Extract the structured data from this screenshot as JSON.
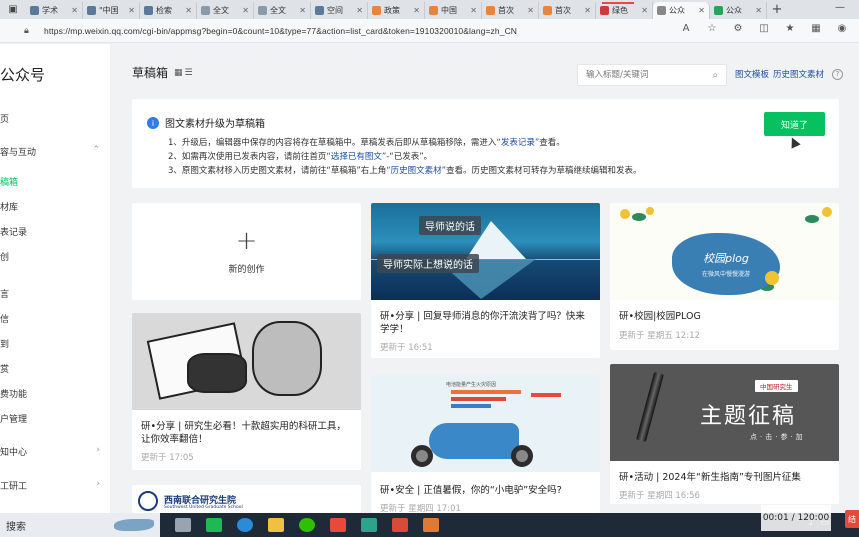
{
  "browser": {
    "tabs": [
      {
        "label": "学术",
        "color": "#5b7a99"
      },
      {
        "label": "\"中国",
        "color": "#5b7a99"
      },
      {
        "label": "检索",
        "color": "#5b7a99"
      },
      {
        "label": "全文",
        "color": "#8a9aa8"
      },
      {
        "label": "全文",
        "color": "#8a9aa8"
      },
      {
        "label": "空间",
        "color": "#5b7a99"
      },
      {
        "label": "政策",
        "color": "#e8843b"
      },
      {
        "label": "中国",
        "color": "#e8843b"
      },
      {
        "label": "首次",
        "color": "#e8843b"
      },
      {
        "label": "首次",
        "color": "#e8843b"
      },
      {
        "label": "绿色",
        "color": "#d0393b"
      },
      {
        "label": "公众",
        "color": "#888888"
      },
      {
        "label": "公众",
        "color": "#2aa35a"
      }
    ],
    "url": "https://mp.weixin.qq.com/cgi-bin/appmsg?begin=0&count=10&type=77&action=list_card&token=1910320010&lang=zh_CN"
  },
  "sidebar": {
    "logo": "公众号",
    "items": [
      {
        "label": "页",
        "chevron": ""
      },
      {
        "label": "容与互动",
        "chevron": "⌃"
      },
      {
        "label": "稿箱",
        "chevron": ""
      },
      {
        "label": "材库",
        "chevron": ""
      },
      {
        "label": "表记录",
        "chevron": ""
      },
      {
        "label": "创",
        "chevron": ""
      },
      {
        "label": "言",
        "chevron": ""
      },
      {
        "label": "信",
        "chevron": ""
      },
      {
        "label": "到",
        "chevron": ""
      },
      {
        "label": "赏",
        "chevron": ""
      },
      {
        "label": "费功能",
        "chevron": ""
      },
      {
        "label": "户管理",
        "chevron": ""
      },
      {
        "label": "知中心",
        "chevron": "›"
      },
      {
        "label": "工研工",
        "chevron": "›"
      }
    ]
  },
  "header": {
    "title": "草稿箱",
    "search_placeholder": "输入标题/关键词",
    "link_templates": "图文模板",
    "link_history": "历史图文素材",
    "help": "?"
  },
  "notice": {
    "title": "图文素材升级为草稿箱",
    "line1_a": "1、升级后，编辑器中保存的内容将存在草稿箱中。草稿发表后即从草稿箱移除，需进入",
    "line1_link": "“发表记录”",
    "line1_b": "查看。",
    "line2_a": "2、如需再次使用已发表内容，请前往首页",
    "line2_link": "“选择已有图文”",
    "line2_b": "-“已发表”。",
    "line3_a": "3、原图文素材移入历史图文素材，请前往“草稿箱”右上角",
    "line3_link": "“历史图文素材”",
    "line3_b": "查看。历史图文素材可转存为草稿继续编辑和发表。",
    "button": "知道了"
  },
  "cards": {
    "new": {
      "label": "新的创作"
    },
    "c1": {
      "tag1": "导师说的话",
      "tag2": "导师实际上想说的话",
      "title": "研•分享 | 回复导师消息的你汗流浃背了吗？快来学学！",
      "time": "更新于 16:51"
    },
    "c2": {
      "big": "校园plog",
      "sub": "在微风中慢慢漫游",
      "title": "研•校园|校园PLOG",
      "time": "更新于 星期五 12:12"
    },
    "c3": {
      "title": "研•分享 | 研究生必看！十款超实用的科研工具，让你效率翻倍！",
      "time": "更新于 17:05"
    },
    "c4": {
      "chart_title": "电池能量产生火灾原因",
      "title": "研•安全 | 正值暑假，你的“小电驴”安全吗?",
      "time": "更新于 星期四 17:01"
    },
    "c5": {
      "logo": "中国研究生",
      "big": "主题征稿",
      "sub": "点·击·参·加",
      "title": "研•活动 | 2024年“新生指南”专刊图片征集",
      "time": "更新于 星期四 16:56"
    },
    "c6": {
      "school": "西南联合研究生院",
      "school_en": "Southwest United Graduate School"
    }
  },
  "taskbar": {
    "search": "搜索",
    "recorder_time": "00:01 / 120:00",
    "rec_label": "结"
  }
}
